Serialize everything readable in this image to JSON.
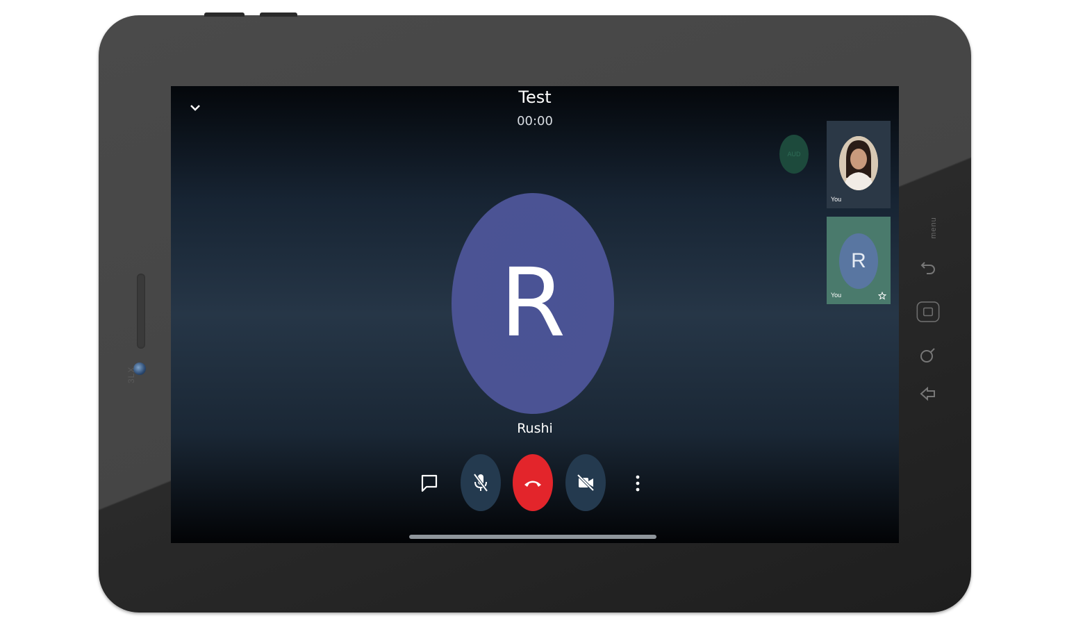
{
  "call": {
    "title": "Test",
    "timer": "00:00",
    "participant_name": "Rushi",
    "participant_initial": "R",
    "audio_badge": "AUD"
  },
  "participants": [
    {
      "name": "You",
      "type": "photo"
    },
    {
      "name": "You",
      "type": "initial",
      "initial": "R",
      "icon": "star-icon"
    }
  ],
  "controls": {
    "chat_icon": "chat-icon",
    "mute_icon": "mic-off-icon",
    "end_icon": "end-call-icon",
    "camera_icon": "video-off-icon",
    "more_icon": "more-vertical-icon"
  },
  "device": {
    "brand": "3LX",
    "side_label": "menu"
  },
  "colors": {
    "avatar": "#4b5394",
    "end_call": "#e3252b",
    "control_bg": "#243a4f",
    "audio_badge": "#1d4a3c",
    "tile_active": "#4a7a6c"
  }
}
